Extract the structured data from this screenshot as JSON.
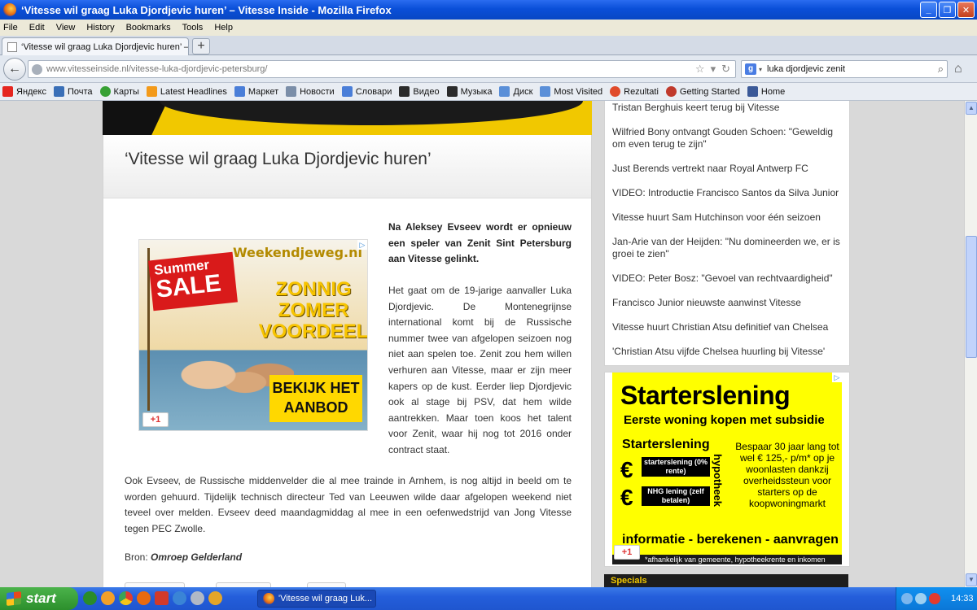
{
  "window": {
    "title": "‘Vitesse wil graag Luka Djordjevic huren’ – Vitesse Inside - Mozilla Firefox"
  },
  "menu": [
    "File",
    "Edit",
    "View",
    "History",
    "Bookmarks",
    "Tools",
    "Help"
  ],
  "tab": {
    "label": "‘Vitesse wil graag Luka Djordjevic huren’ – Vi..."
  },
  "nav": {
    "url_domain": "www.vitesseinside.nl",
    "url_path": "/vitesse-luka-djordjevic-petersburg/",
    "search_value": "luka djordjevic zenit"
  },
  "bookmarks": [
    {
      "label": "Яндекс",
      "color": "#e52620"
    },
    {
      "label": "Почта",
      "color": "#3a6fb7"
    },
    {
      "label": "Карты",
      "color": "#37a034"
    },
    {
      "label": "Latest Headlines",
      "color": "#f39a1a"
    },
    {
      "label": "Маркет",
      "color": "#4a7ed8"
    },
    {
      "label": "Новости",
      "color": "#7b8ea8"
    },
    {
      "label": "Словари",
      "color": "#4a7ed8"
    },
    {
      "label": "Видео",
      "color": "#2b2b2b"
    },
    {
      "label": "Музыка",
      "color": "#2b2b2b"
    },
    {
      "label": "Диск",
      "color": "#5a8fd8"
    },
    {
      "label": "Most Visited",
      "color": "#5a8fd8"
    },
    {
      "label": "Rezultati",
      "color": "#e04a2a"
    },
    {
      "label": "Getting Started",
      "color": "#c0392b"
    },
    {
      "label": "Home",
      "color": "#3b5998"
    }
  ],
  "article": {
    "title": "‘Vitesse wil graag Luka Djordjevic huren’",
    "lead": "Na Aleksey Evseev wordt er opnieuw een speler van Zenit Sint Petersburg aan Vitesse gelinkt.",
    "para1": "Het gaat om de 19-jarige aanvaller Luka Djordjevic. De Montenegrijnse international komt bij de Russische nummer twee van afgelopen seizoen nog niet aan spelen toe. Zenit zou hem willen verhuren aan Vitesse, maar er zijn meer kapers op de kust. Eerder liep Djordjevic ook al stage bij PSV, dat hem wilde aantrekken. Maar toen koos het talent voor Zenit, waar hij nog tot 2016 onder contract staat.",
    "para2": "Ook Evseev, de Russische middenvelder die al mee trainde in Arnhem, is nog altijd in beeld om te worden gehuurd. Tijdelijk technisch directeur Ted van Leeuwen wilde daar afgelopen weekend niet teveel over melden. Evseev deed maandagmiddag al mee in een oefenwedstrijd van Jong Vitesse tegen PEC Zwolle.",
    "source_label": "Bron:",
    "source_name": "Omroep Gelderland"
  },
  "ad_left": {
    "brand": "Weekendjeweg.nl",
    "sale_1": "Summer",
    "sale_2": "SALE",
    "headline": "ZONNIG ZOMER VOORDEEL",
    "cta": "BEKIJK HET AANBOD",
    "gplus": "+1"
  },
  "sidebar": {
    "items": [
      "Tristan Berghuis keert terug bij Vitesse",
      "Wilfried Bony ontvangt Gouden Schoen: \"Geweldig om even terug te zijn\"",
      "Just Berends vertrekt naar Royal Antwerp FC",
      "VIDEO: Introductie Francisco Santos da Silva Junior",
      "Vitesse huurt Sam Hutchinson voor één seizoen",
      "Jan-Arie van der Heijden: \"Nu domineerden we, er is groei te zien\"",
      "VIDEO: Peter Bosz: \"Gevoel van rechtvaardigheid\"",
      "Francisco Junior nieuwste aanwinst Vitesse",
      "Vitesse huurt Christian Atsu definitief van Chelsea",
      "'Christian Atsu vijfde Chelsea huurling bij Vitesse'"
    ],
    "specials": "Specials"
  },
  "ad_right": {
    "title": "Starterslening",
    "subtitle": "Eerste woning kopen met subsidie",
    "label": "Starterslening",
    "box1": "starterslening (0% rente)",
    "box2": "NHG lening (zelf betalen)",
    "vertical": "hypotheek",
    "body": "Bespaar 30 jaar lang tot wel € 125,- p/m* op je woonlasten dankzij overheidssteun voor starters op de koopwoningmarkt",
    "bottom": "informatie - berekenen - aanvragen",
    "fine": "*afhankelijk van gemeente, hypotheekrente en inkomen",
    "gplus": "+1",
    "euro": "€"
  },
  "taskbar": {
    "start": "start",
    "task": "'Vitesse wil graag Luk...",
    "clock": "14:33"
  }
}
